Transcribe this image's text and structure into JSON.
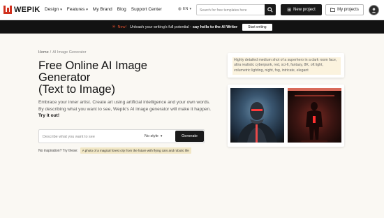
{
  "header": {
    "logo_text": "WEPIK",
    "nav": [
      {
        "label": "Design",
        "has_menu": true
      },
      {
        "label": "Features",
        "has_menu": true
      },
      {
        "label": "My Brand",
        "has_menu": false
      },
      {
        "label": "Blog",
        "has_menu": false
      },
      {
        "label": "Support Center",
        "has_menu": false
      }
    ],
    "language": "EN",
    "search_placeholder": "Search for free templates here",
    "new_project_label": "New project",
    "my_projects_label": "My projects"
  },
  "banner": {
    "new_label": "New!",
    "text": "Unleash your writing's full potential -",
    "strong": "say hello to the AI Writer",
    "button_label": "Start writing"
  },
  "hero": {
    "breadcrumb": {
      "home": "Home",
      "current": "AI Image Generator"
    },
    "title_line1": "Free Online AI Image",
    "title_line2": "Generator",
    "title_line3": "(Text to Image)",
    "description": "Embrace your inner artist. Create art using artificial intelligence and your own words. By describing what you want to see, Wepik's AI image generator will make it happen.",
    "description_strong": "Try it out!",
    "input_placeholder": "Describe what you want to see",
    "style_label": "No style",
    "generate_label": "Generate",
    "inspiration_label": "No inspiration? Try these:",
    "inspiration_chip": "A photo of a magical forest city from the future with flying cars and robotic life"
  },
  "example": {
    "prompt": "Highly detailed medium shot of a superhero in a dark room face, ultra realistic cyberpunk, red, sci-fi, fantasy, 8K, oft light, volumetric lighting, night, fog, intricate, elegant"
  },
  "colors": {
    "brand": "#d0301e",
    "accent": "#e0502f",
    "dark": "#1a1a1a",
    "hero_bg": "#faf8f3",
    "chip_bg": "#f1e7c5"
  }
}
